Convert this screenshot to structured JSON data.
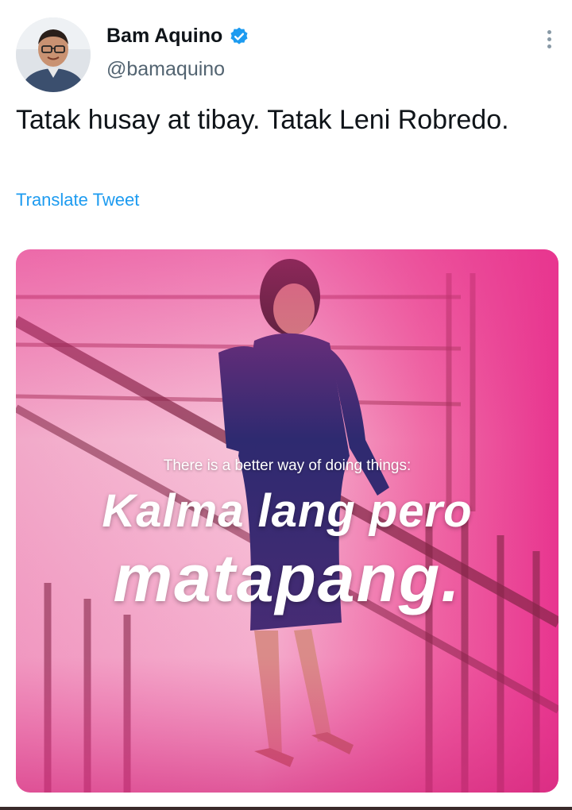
{
  "tweet": {
    "author_name": "Bam Aquino",
    "author_handle": "@bamaquino",
    "text": "Tatak husay at tibay. Tatak Leni Robredo.",
    "translate_label": "Translate Tweet"
  },
  "media": {
    "small_caption": "There is a better way of doing things:",
    "headline_line1": "Kalma lang pero",
    "headline_line2": "matapang."
  },
  "colors": {
    "verified_badge": "#1d9bf0",
    "link": "#1d9bf0",
    "media_magenta": "#e8358f",
    "dress_navy": "#2e2a70"
  },
  "icons": {
    "verified": "verified-badge-icon",
    "more": "more-options-icon"
  }
}
